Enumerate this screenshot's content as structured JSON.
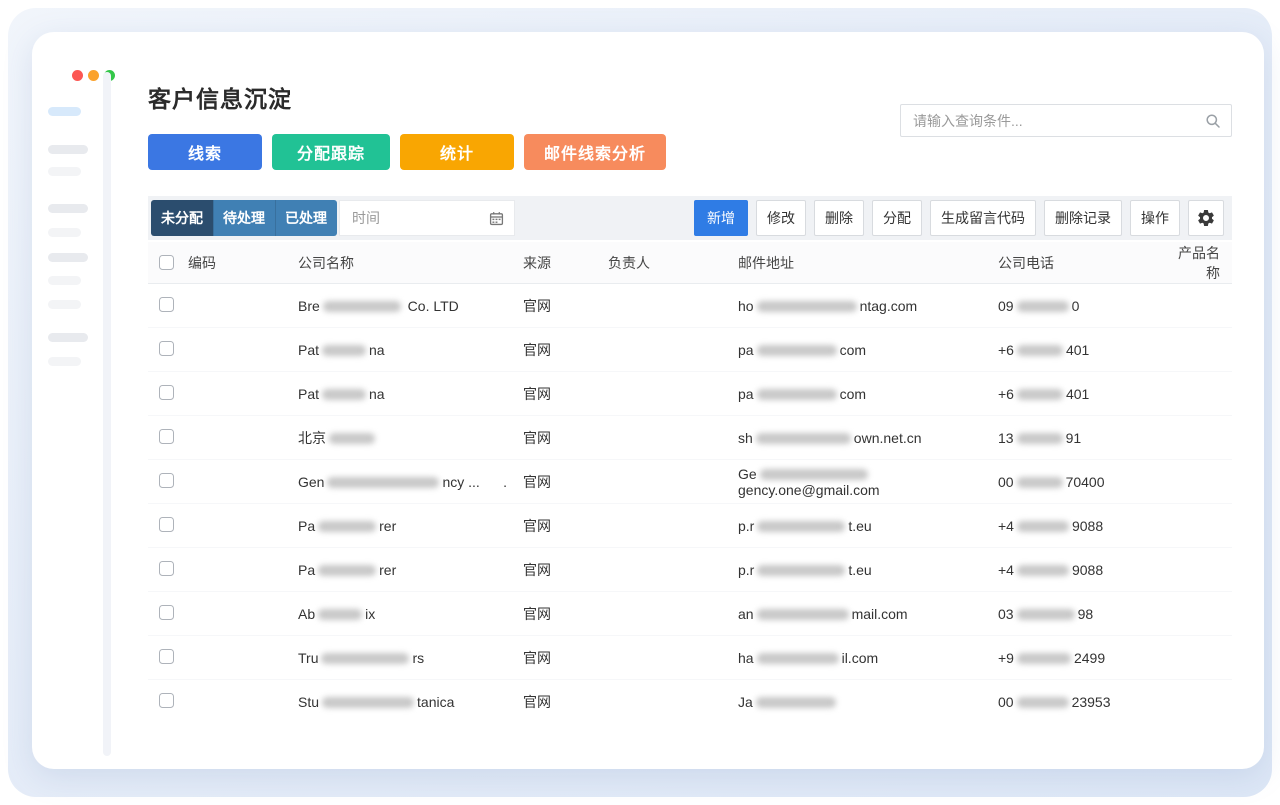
{
  "page": {
    "title": "客户信息沉淀"
  },
  "search": {
    "placeholder": "请输入查询条件...",
    "icon": "search-icon"
  },
  "hero_buttons": [
    {
      "label": "线索",
      "color": "#3b77e3"
    },
    {
      "label": "分配跟踪",
      "color": "#21c295"
    },
    {
      "label": "统计",
      "color": "#f9a602"
    },
    {
      "label": "邮件线索分析",
      "color": "#f78b5d"
    }
  ],
  "filter": {
    "tabs": [
      {
        "label": "未分配",
        "active": true
      },
      {
        "label": "待处理",
        "active": false
      },
      {
        "label": "已处理",
        "active": false
      }
    ],
    "date_placeholder": "时间",
    "date_icon": "calendar-icon"
  },
  "toolbar": {
    "buttons": [
      {
        "label": "新增",
        "primary": true
      },
      {
        "label": "修改",
        "primary": false
      },
      {
        "label": "删除",
        "primary": false
      },
      {
        "label": "分配",
        "primary": false
      },
      {
        "label": "生成留言代码",
        "primary": false
      },
      {
        "label": "删除记录",
        "primary": false
      },
      {
        "label": "操作",
        "primary": false
      }
    ],
    "settings_icon": "gear-icon"
  },
  "table": {
    "columns": [
      "编码",
      "公司名称",
      "来源",
      "负责人",
      "邮件地址",
      "公司电话",
      "产品名称"
    ],
    "rows": [
      {
        "company": {
          "pre": "Bre",
          "blur": 78,
          "suf": " Co. LTD"
        },
        "source": "官网",
        "email": {
          "pre": "ho",
          "blur": 100,
          "suf": "ntag.com"
        },
        "phone": {
          "pre": "09",
          "blur": 52,
          "suf": "0"
        }
      },
      {
        "company": {
          "pre": "Pat",
          "blur": 44,
          "suf": "na"
        },
        "source": "官网",
        "email": {
          "pre": "pa",
          "blur": 80,
          "suf": "com"
        },
        "phone": {
          "pre": "+6",
          "blur": 46,
          "suf": "401"
        }
      },
      {
        "company": {
          "pre": "Pat",
          "blur": 44,
          "suf": "na"
        },
        "source": "官网",
        "email": {
          "pre": "pa",
          "blur": 80,
          "suf": "com"
        },
        "phone": {
          "pre": "+6",
          "blur": 46,
          "suf": "401"
        }
      },
      {
        "company": {
          "pre": "北京",
          "blur": 46,
          "suf": ""
        },
        "source": "官网",
        "email": {
          "pre": "sh",
          "blur": 95,
          "suf": "own.net.cn"
        },
        "phone": {
          "pre": "13",
          "blur": 46,
          "suf": "91"
        }
      },
      {
        "company": {
          "pre": "Gen",
          "blur": 112,
          "suf": "ncy ...      ."
        },
        "source": "官网",
        "email": {
          "pre": "Ge",
          "blur": 108,
          "suf": "gency.one@gmail.com"
        },
        "phone": {
          "pre": "00",
          "blur": 46,
          "suf": "70400"
        }
      },
      {
        "company": {
          "pre": "Pa",
          "blur": 58,
          "suf": "rer"
        },
        "source": "官网",
        "email": {
          "pre": "p.r",
          "blur": 88,
          "suf": "t.eu"
        },
        "phone": {
          "pre": "+4",
          "blur": 52,
          "suf": "9088"
        }
      },
      {
        "company": {
          "pre": "Pa",
          "blur": 58,
          "suf": "rer"
        },
        "source": "官网",
        "email": {
          "pre": "p.r",
          "blur": 88,
          "suf": "t.eu"
        },
        "phone": {
          "pre": "+4",
          "blur": 52,
          "suf": "9088"
        }
      },
      {
        "company": {
          "pre": "Ab",
          "blur": 44,
          "suf": "ix"
        },
        "source": "官网",
        "email": {
          "pre": "an",
          "blur": 92,
          "suf": "mail.com"
        },
        "phone": {
          "pre": "03",
          "blur": 58,
          "suf": "98"
        }
      },
      {
        "company": {
          "pre": "Tru",
          "blur": 88,
          "suf": "rs"
        },
        "source": "官网",
        "email": {
          "pre": "ha",
          "blur": 82,
          "suf": "il.com"
        },
        "phone": {
          "pre": "+9",
          "blur": 54,
          "suf": "2499"
        }
      },
      {
        "company": {
          "pre": "Stu",
          "blur": 92,
          "suf": "tanica"
        },
        "source": "官网",
        "email": {
          "pre": "Ja",
          "blur": 80,
          "suf": ""
        },
        "phone": {
          "pre": "00",
          "blur": 52,
          "suf": "23953"
        }
      }
    ]
  },
  "sidebar": {
    "bars": [
      "active",
      "dark",
      "light",
      "dark",
      "light",
      "dark",
      "light",
      "light",
      "dark",
      "light"
    ]
  },
  "colors": {
    "primary_blue": "#2f7ce5",
    "tab_active": "#2b4d6e",
    "tab_inactive": "#4080b4",
    "toolbar_bg": "#f0f2f5"
  }
}
